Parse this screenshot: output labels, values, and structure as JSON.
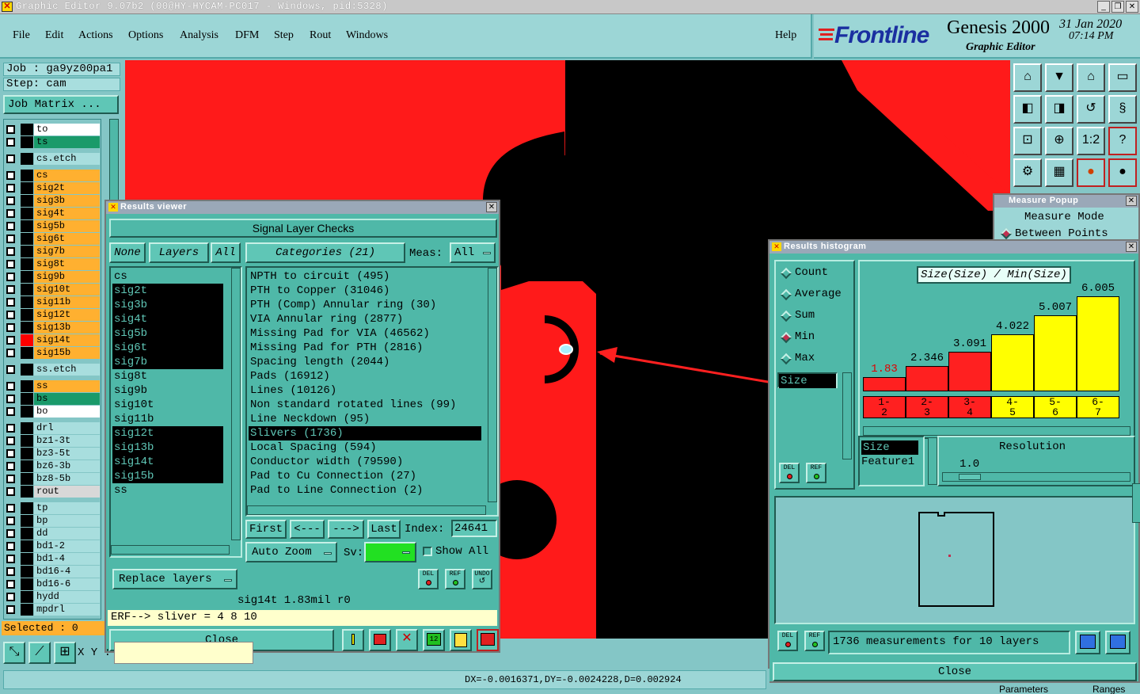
{
  "window": {
    "title": "Graphic Editor 9.07b2 (00@HY-HYCAM-PC017 - Windows, pid:5328)",
    "min": "_",
    "restore": "❐",
    "close": "✕"
  },
  "menu": {
    "items": [
      "File",
      "Edit",
      "Actions",
      "Options",
      "Analysis",
      "DFM",
      "Step",
      "Rout",
      "Windows"
    ],
    "help": "Help"
  },
  "brand": {
    "logo": "Frontline",
    "product": "Genesis 2000",
    "subtitle": "Graphic Editor",
    "date": "31 Jan 2020",
    "time": "07:14 PM"
  },
  "left": {
    "job": "Job : ga9yz00pa1",
    "step": "Step: cam",
    "job_matrix": "Job Matrix ...",
    "selected": "Selected : 0",
    "layers": [
      {
        "name": "to",
        "color": "#ffffff",
        "swatch": "#000000"
      },
      {
        "name": "ts",
        "color": "#1a9a6a",
        "swatch": "#000000"
      },
      {
        "name": "cs.etch",
        "color": "#a8dede",
        "swatch": "#000000"
      },
      {
        "name": "cs",
        "color": "#ffb030",
        "swatch": "#000000"
      },
      {
        "name": "sig2t",
        "color": "#ffb030",
        "swatch": "#000000"
      },
      {
        "name": "sig3b",
        "color": "#ffb030",
        "swatch": "#000000"
      },
      {
        "name": "sig4t",
        "color": "#ffb030",
        "swatch": "#000000"
      },
      {
        "name": "sig5b",
        "color": "#ffb030",
        "swatch": "#000000"
      },
      {
        "name": "sig6t",
        "color": "#ffb030",
        "swatch": "#000000"
      },
      {
        "name": "sig7b",
        "color": "#ffb030",
        "swatch": "#000000"
      },
      {
        "name": "sig8t",
        "color": "#ffb030",
        "swatch": "#000000"
      },
      {
        "name": "sig9b",
        "color": "#ffb030",
        "swatch": "#000000"
      },
      {
        "name": "sig10t",
        "color": "#ffb030",
        "swatch": "#000000"
      },
      {
        "name": "sig11b",
        "color": "#ffb030",
        "swatch": "#000000"
      },
      {
        "name": "sig12t",
        "color": "#ffb030",
        "swatch": "#000000"
      },
      {
        "name": "sig13b",
        "color": "#ffb030",
        "swatch": "#000000"
      },
      {
        "name": "sig14t",
        "color": "#ffb030",
        "swatch": "#ff0000"
      },
      {
        "name": "sig15b",
        "color": "#ffb030",
        "swatch": "#000000"
      },
      {
        "name": "ss.etch",
        "color": "#a8dede",
        "swatch": "#000000"
      },
      {
        "name": "ss",
        "color": "#ffb030",
        "swatch": "#000000"
      },
      {
        "name": "bs",
        "color": "#1a9a6a",
        "swatch": "#000000"
      },
      {
        "name": "bo",
        "color": "#ffffff",
        "swatch": "#000000"
      },
      {
        "name": "drl",
        "color": "#a8dede",
        "swatch": "#000000"
      },
      {
        "name": "bz1-3t",
        "color": "#a8dede",
        "swatch": "#000000"
      },
      {
        "name": "bz3-5t",
        "color": "#a8dede",
        "swatch": "#000000"
      },
      {
        "name": "bz6-3b",
        "color": "#a8dede",
        "swatch": "#000000"
      },
      {
        "name": "bz8-5b",
        "color": "#a8dede",
        "swatch": "#000000"
      },
      {
        "name": "rout",
        "color": "#d8d8d8",
        "swatch": "#000000"
      },
      {
        "name": "tp",
        "color": "#a8dede",
        "swatch": "#000000"
      },
      {
        "name": "bp",
        "color": "#a8dede",
        "swatch": "#000000"
      },
      {
        "name": "dd",
        "color": "#a8dede",
        "swatch": "#000000"
      },
      {
        "name": "bd1-2",
        "color": "#a8dede",
        "swatch": "#000000"
      },
      {
        "name": "bd1-4",
        "color": "#a8dede",
        "swatch": "#000000"
      },
      {
        "name": "bd16-4",
        "color": "#a8dede",
        "swatch": "#000000"
      },
      {
        "name": "bd16-6",
        "color": "#a8dede",
        "swatch": "#000000"
      },
      {
        "name": "hydd",
        "color": "#a8dede",
        "swatch": "#000000"
      },
      {
        "name": "mpdrl",
        "color": "#a8dede",
        "swatch": "#000000"
      }
    ]
  },
  "results_viewer": {
    "title": "Results viewer",
    "header": "Signal Layer Checks",
    "none": "None",
    "layers": "Layers",
    "all": "All",
    "categories": "Categories (21)",
    "meas_label": "Meas:",
    "meas_value": "All",
    "layer_list": [
      {
        "name": "cs",
        "selected": false
      },
      {
        "name": "sig2t",
        "selected": true
      },
      {
        "name": "sig3b",
        "selected": true
      },
      {
        "name": "sig4t",
        "selected": true
      },
      {
        "name": "sig5b",
        "selected": true
      },
      {
        "name": "sig6t",
        "selected": true
      },
      {
        "name": "sig7b",
        "selected": true
      },
      {
        "name": "sig8t",
        "selected": false
      },
      {
        "name": "sig9b",
        "selected": false
      },
      {
        "name": "sig10t",
        "selected": false
      },
      {
        "name": "sig11b",
        "selected": false
      },
      {
        "name": "sig12t",
        "selected": true
      },
      {
        "name": "sig13b",
        "selected": true
      },
      {
        "name": "sig14t",
        "selected": true
      },
      {
        "name": "sig15b",
        "selected": true
      },
      {
        "name": "ss",
        "selected": false
      }
    ],
    "category_list": [
      {
        "name": "NPTH to circuit (495)",
        "selected": false
      },
      {
        "name": "PTH to Copper (31046)",
        "selected": false
      },
      {
        "name": "PTH (Comp) Annular ring (30)",
        "selected": false
      },
      {
        "name": "VIA Annular ring (2877)",
        "selected": false
      },
      {
        "name": "Missing Pad for VIA (46562)",
        "selected": false
      },
      {
        "name": "Missing Pad for PTH (2816)",
        "selected": false
      },
      {
        "name": "Spacing length (2044)",
        "selected": false
      },
      {
        "name": "Pads (16912)",
        "selected": false
      },
      {
        "name": "Lines (10126)",
        "selected": false
      },
      {
        "name": "Non standard rotated lines (99)",
        "selected": false
      },
      {
        "name": "Line Neckdown (95)",
        "selected": false
      },
      {
        "name": "Slivers (1736)",
        "selected": true
      },
      {
        "name": "Local Spacing (594)",
        "selected": false
      },
      {
        "name": "Conductor width (79590)",
        "selected": false
      },
      {
        "name": "Pad to Cu Connection (27)",
        "selected": false
      },
      {
        "name": "Pad to Line Connection (2)",
        "selected": false
      }
    ],
    "first": "First",
    "prev": "<---",
    "next": "--->",
    "last": "Last",
    "index_label": "Index:",
    "index_value": "24641",
    "auto_zoom": "Auto Zoom",
    "sv_label": "Sv:",
    "show_all": "Show All",
    "replace_layers": "Replace layers",
    "del": "DEL",
    "ref": "REF",
    "undo": "UNDO",
    "info_line": "sig14t 1.83mil r0",
    "erf_line": "ERF--> sliver = 4 8 10",
    "close": "Close"
  },
  "measure_popup": {
    "title": "Measure Popup",
    "mode": "Measure Mode",
    "option": "Between Points"
  },
  "histogram": {
    "title": "Results histogram",
    "modes": [
      {
        "label": "Count",
        "on": false
      },
      {
        "label": "Average",
        "on": false
      },
      {
        "label": "Sum",
        "on": false
      },
      {
        "label": "Min",
        "on": true
      },
      {
        "label": "Max",
        "on": false
      }
    ],
    "list_item": "Size",
    "chart_title": "Size(Size) / Min(Size)",
    "bins": [
      {
        "label": "1-\n2",
        "value": "1.83",
        "frac": 0.12,
        "color": "#ff2020",
        "textcolor": "#e00000"
      },
      {
        "label": "2-\n3",
        "value": "2.346",
        "frac": 0.21,
        "color": "#ff2020",
        "textcolor": "#000000"
      },
      {
        "label": "3-\n4",
        "value": "3.091",
        "frac": 0.33,
        "color": "#ff2020",
        "textcolor": "#000000"
      },
      {
        "label": "4-\n5",
        "value": "4.022",
        "frac": 0.48,
        "color": "#ffff00",
        "textcolor": "#000000"
      },
      {
        "label": "5-\n6",
        "value": "5.007",
        "frac": 0.64,
        "color": "#ffff00",
        "textcolor": "#000000"
      },
      {
        "label": "6-\n7",
        "value": "6.005",
        "frac": 0.8,
        "color": "#ffff00",
        "textcolor": "#000000"
      }
    ],
    "attr_items": [
      "Size",
      "Feature1"
    ],
    "resolution_label": "Resolution",
    "resolution_value": "1.0",
    "del": "DEL",
    "ref": "REF",
    "measurements": "1736 measurements for 10 layers",
    "close": "Close",
    "parameters": "Parameters",
    "ranges": "Ranges"
  },
  "status": {
    "xy": "X Y :",
    "coords": "DX=-0.0016371,DY=-0.0024228,D=0.002924"
  }
}
